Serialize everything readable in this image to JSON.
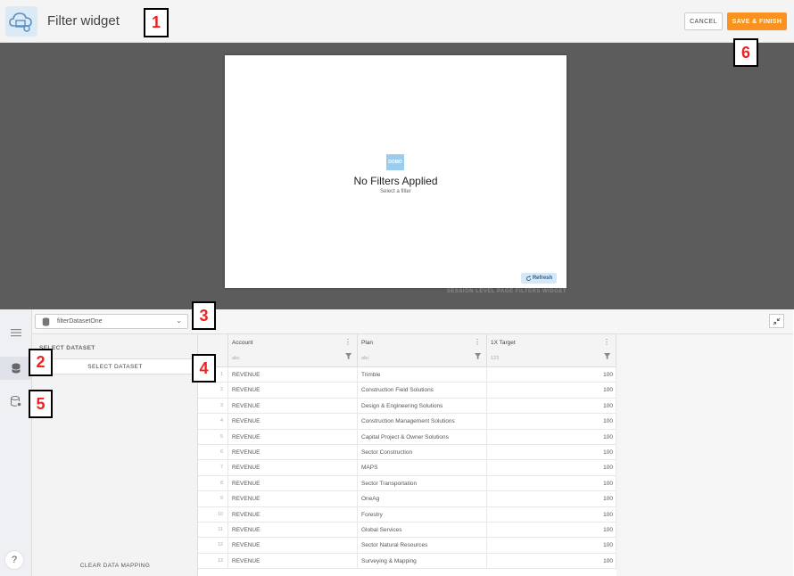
{
  "header": {
    "title": "Filter widget",
    "cancel_label": "CANCEL",
    "save_label": "SAVE & FINISH"
  },
  "preview": {
    "logo_text": "DOMO",
    "empty_title": "No Filters Applied",
    "empty_subtitle": "Select a filter",
    "refresh_label": "Refresh",
    "caption": "SESSION LEVEL PAGE FILTERS WIDGET"
  },
  "dataset": {
    "selected": "filterDatasetOne"
  },
  "panel": {
    "heading": "SELECT DATASET",
    "select_button": "SELECT DATASET",
    "clear_button": "CLEAR DATA MAPPING"
  },
  "help": {
    "label": "?"
  },
  "table": {
    "columns": [
      {
        "name": "Account",
        "type": "abc"
      },
      {
        "name": "Plan",
        "type": "abc"
      },
      {
        "name": "1X Target",
        "type": "123"
      }
    ],
    "rows": [
      {
        "num": "1",
        "account": "REVENUE",
        "plan": "Trimble",
        "target": "100"
      },
      {
        "num": "2",
        "account": "REVENUE",
        "plan": "Construction Field Solutions",
        "target": "100"
      },
      {
        "num": "3",
        "account": "REVENUE",
        "plan": "Design & Engineering Solutions",
        "target": "100"
      },
      {
        "num": "4",
        "account": "REVENUE",
        "plan": "Construction Management Solutions",
        "target": "100"
      },
      {
        "num": "5",
        "account": "REVENUE",
        "plan": "Capital Project & Owner Solutions",
        "target": "100"
      },
      {
        "num": "6",
        "account": "REVENUE",
        "plan": "Sector Construction",
        "target": "100"
      },
      {
        "num": "7",
        "account": "REVENUE",
        "plan": "MAPS",
        "target": "100"
      },
      {
        "num": "8",
        "account": "REVENUE",
        "plan": "Sector Transportation",
        "target": "100"
      },
      {
        "num": "9",
        "account": "REVENUE",
        "plan": "OneAg",
        "target": "100"
      },
      {
        "num": "10",
        "account": "REVENUE",
        "plan": "Forestry",
        "target": "100"
      },
      {
        "num": "11",
        "account": "REVENUE",
        "plan": "Global Services",
        "target": "100"
      },
      {
        "num": "12",
        "account": "REVENUE",
        "plan": "Sector Natural Resources",
        "target": "100"
      },
      {
        "num": "13",
        "account": "REVENUE",
        "plan": "Surveying & Mapping",
        "target": "100"
      }
    ]
  },
  "markers": [
    "1",
    "2",
    "3",
    "4",
    "5",
    "6"
  ],
  "colors": {
    "accent": "#f7931e",
    "marker_text": "#ee2222",
    "preview_bg": "#5c5c5c"
  }
}
